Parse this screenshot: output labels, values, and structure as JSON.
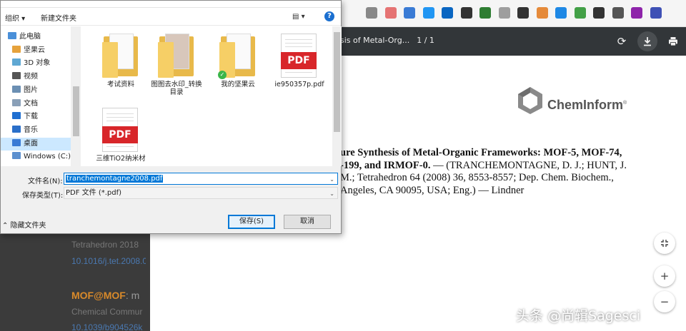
{
  "browser": {
    "extensions": [
      {
        "name": "ext-1-icon",
        "color": "#888888"
      },
      {
        "name": "ext-2-icon",
        "color": "#e57373"
      },
      {
        "name": "ext-3-icon",
        "color": "#3a7bd5"
      },
      {
        "name": "ext-4-icon",
        "color": "#2196f3"
      },
      {
        "name": "ext-5-icon",
        "color": "#0a66c2"
      },
      {
        "name": "ext-6-icon",
        "color": "#333333"
      },
      {
        "name": "ext-7-icon",
        "color": "#2e7d32"
      },
      {
        "name": "ext-8-icon",
        "color": "#9e9e9e"
      },
      {
        "name": "ext-9-icon",
        "color": "#333333"
      },
      {
        "name": "ext-10-icon",
        "color": "#e58a3a"
      },
      {
        "name": "ext-11-icon",
        "color": "#1e88e5"
      },
      {
        "name": "ext-12-icon",
        "color": "#43a047"
      },
      {
        "name": "ext-13-icon",
        "color": "#333333"
      },
      {
        "name": "ext-14-icon",
        "color": "#555555"
      },
      {
        "name": "ext-15-icon",
        "color": "#8e24aa"
      },
      {
        "name": "ext-16-icon",
        "color": "#3f51b5"
      }
    ]
  },
  "pdf_viewer": {
    "title": "sis of Metal-Org...",
    "pages": "1 / 1",
    "logo_text": "ChemInform",
    "logo_mark": "®",
    "article_lines": [
      {
        "bold": "ure Synthesis of Metal-Organic Frameworks: MOF-5, MOF-74,",
        "rest": ""
      },
      {
        "bold": "-199, and IRMOF-0.",
        "rest": " — (TRANCHEMONTAGNE, D. J.; HUNT, J."
      },
      {
        "bold": "",
        "rest": "M.; Tetrahedron 64 (2008) 36, 8553-8557; Dep. Chem. Biochem.,"
      },
      {
        "bold": "",
        "rest": "Angeles, CA 90095, USA; Eng.) — Lindner"
      }
    ]
  },
  "left_page": {
    "journal": "Tetrahedron 2018",
    "doi": "10.1016/j.tet.2008.0",
    "title_prefix": "MOF@MOF",
    "title_rest": ": m",
    "journal2": "Chemical Commur",
    "doi2": "10.1039/b904526k"
  },
  "dialog": {
    "toolbar": {
      "organize": "组织 ▾",
      "new_folder": "新建文件夹",
      "view": "▤ ▾",
      "help": "?"
    },
    "nav_items": [
      {
        "label": "此电脑",
        "color": "#4a90d9",
        "selected": false
      },
      {
        "label": "坚果云",
        "color": "#e6a23c",
        "selected": false
      },
      {
        "label": "3D 对象",
        "color": "#5fa8d3",
        "selected": false
      },
      {
        "label": "视频",
        "color": "#555555",
        "selected": false
      },
      {
        "label": "图片",
        "color": "#6b8fb3",
        "selected": false
      },
      {
        "label": "文档",
        "color": "#8aa0b8",
        "selected": false
      },
      {
        "label": "下载",
        "color": "#1f6fd1",
        "selected": false
      },
      {
        "label": "音乐",
        "color": "#2a6fc9",
        "selected": false
      },
      {
        "label": "桌面",
        "color": "#3a7bd5",
        "selected": true
      },
      {
        "label": "Windows (C:)",
        "color": "#5a8fcf",
        "selected": false
      }
    ],
    "files": [
      {
        "label": "考试资料",
        "type": "folder"
      },
      {
        "label": "图图去水印_转换目录",
        "type": "folder-photo"
      },
      {
        "label": "我的坚果云",
        "type": "folder-sync"
      },
      {
        "label": "ie950357p.pdf",
        "type": "pdf"
      },
      {
        "label": "三维TiO2纳米材",
        "type": "pdf"
      }
    ],
    "pdf_badge": "PDF",
    "filename_label": "文件名(N):",
    "filename_value": "tranchemontagne2008.pdf",
    "filetype_label": "保存类型(T):",
    "filetype_value": "PDF 文件 (*.pdf)",
    "hide_folders": "⌃ 隐藏文件夹",
    "save_button": "保存(S)",
    "cancel_button": "取消"
  },
  "watermark": "头条 @尚辑Sagesci"
}
